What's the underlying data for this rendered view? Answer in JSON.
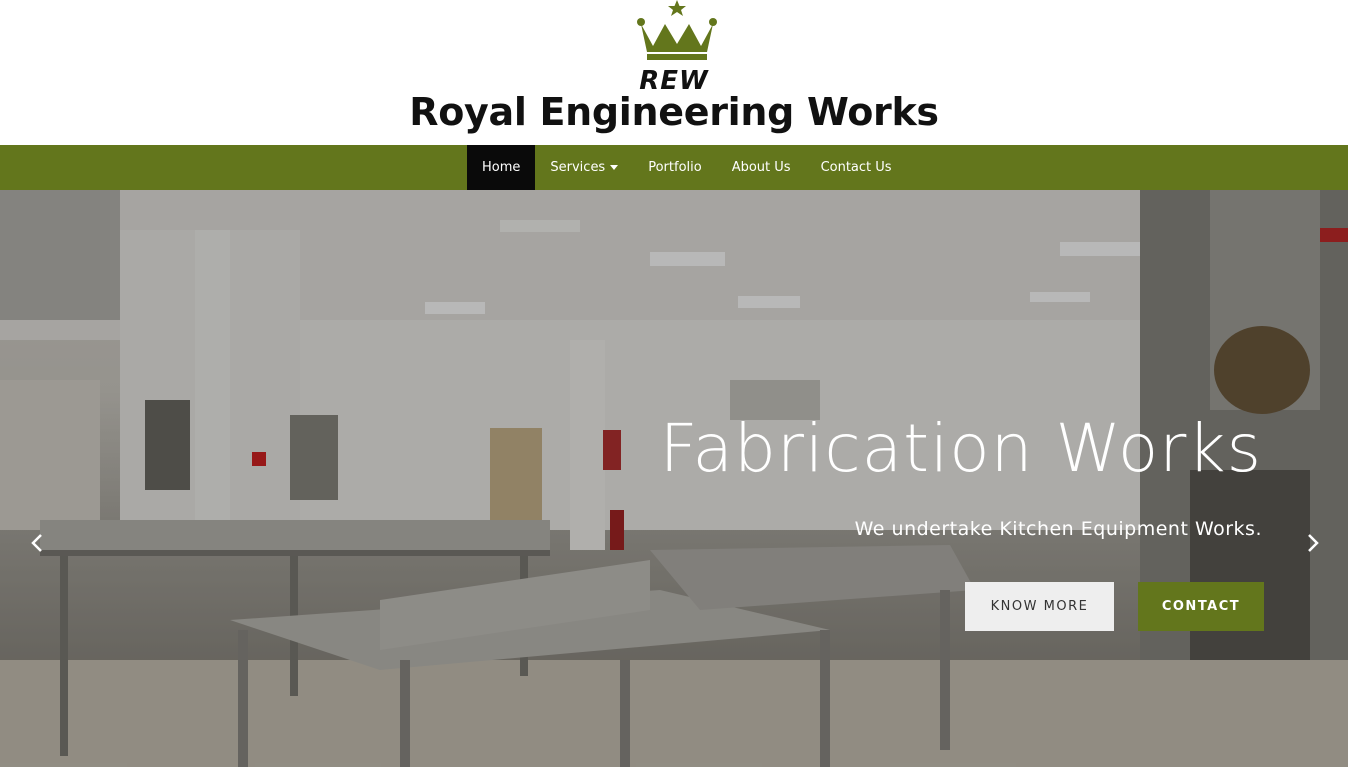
{
  "brand": {
    "logo_text": "REW",
    "site_title": "Royal Engineering Works",
    "accent_color": "#63761c",
    "crown_icon": "crown-icon"
  },
  "nav": {
    "items": [
      {
        "label": "Home",
        "active": true
      },
      {
        "label": "Services",
        "has_dropdown": true
      },
      {
        "label": "Portfolio"
      },
      {
        "label": "About Us"
      },
      {
        "label": "Contact Us"
      }
    ]
  },
  "hero": {
    "title": "Fabrication Works",
    "subtitle": "We undertake Kitchen Equipment Works.",
    "know_more_label": "KNOW MORE",
    "contact_label": "CONTACT",
    "prev_icon": "chevron-left-icon",
    "next_icon": "chevron-right-icon"
  }
}
